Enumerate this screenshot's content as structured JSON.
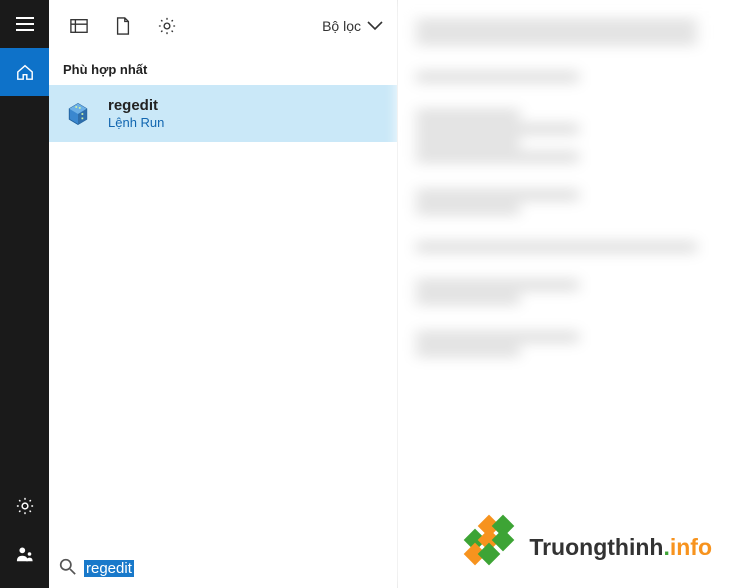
{
  "filter": {
    "label": "Bộ lọc"
  },
  "section": {
    "header": "Phù hợp nhất"
  },
  "result": {
    "name": "regedit",
    "kind": "Lệnh Run"
  },
  "search": {
    "value": "regedit"
  },
  "watermark": {
    "brand_dark": "Truongthinh",
    "brand_dot": ".",
    "brand_tld": "info"
  },
  "colors": {
    "sidebar_bg": "#1a1a1a",
    "accent": "#0e72c9",
    "result_bg": "#cae8f8",
    "link": "#1266b0",
    "wm_green": "#3da435",
    "wm_orange": "#f7931e"
  }
}
